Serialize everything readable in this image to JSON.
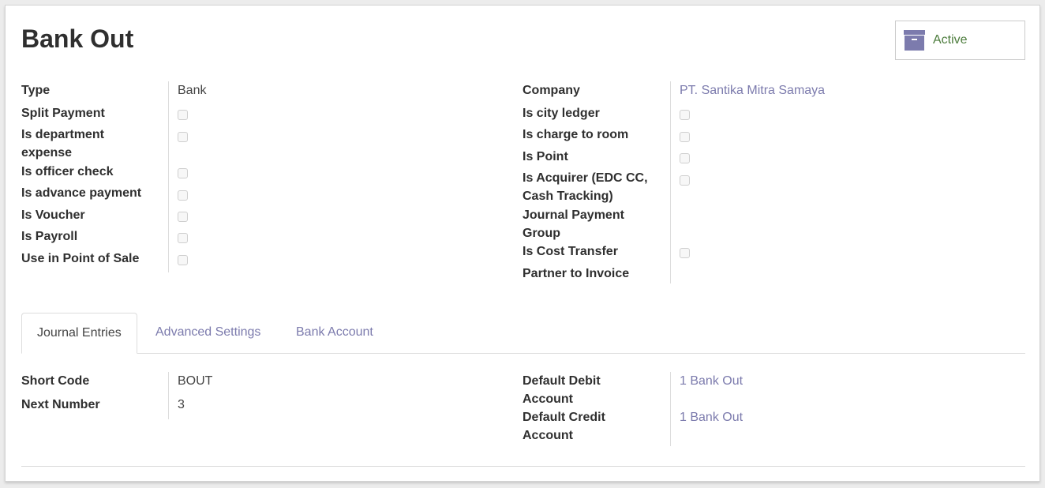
{
  "record": {
    "title": "Bank Out",
    "active_button": {
      "label": "Active",
      "icon": "archive-icon",
      "color": "#7c7bad",
      "text_color": "#4c7c3c"
    }
  },
  "left_group": {
    "fields": [
      {
        "label": "Type",
        "value": "Bank",
        "kind": "text"
      },
      {
        "label": "Split Payment",
        "kind": "checkbox",
        "checked": false
      },
      {
        "label": "Is department expense",
        "kind": "checkbox",
        "checked": false
      },
      {
        "label": "Is officer check",
        "kind": "checkbox",
        "checked": false
      },
      {
        "label": "Is advance payment",
        "kind": "checkbox",
        "checked": false
      },
      {
        "label": "Is Voucher",
        "kind": "checkbox",
        "checked": false
      },
      {
        "label": "Is Payroll",
        "kind": "checkbox",
        "checked": false
      },
      {
        "label": "Use in Point of Sale",
        "kind": "checkbox",
        "checked": false
      }
    ]
  },
  "right_group": {
    "fields": [
      {
        "label": "Company",
        "value": "PT. Santika Mitra Samaya",
        "kind": "link"
      },
      {
        "label": "Is city ledger",
        "kind": "checkbox",
        "checked": false
      },
      {
        "label": "Is charge to room",
        "kind": "checkbox",
        "checked": false
      },
      {
        "label": "Is Point",
        "kind": "checkbox",
        "checked": false
      },
      {
        "label": "Is Acquirer (EDC CC, Cash Tracking)",
        "kind": "checkbox",
        "checked": false
      },
      {
        "label": "Journal Payment Group",
        "value": "",
        "kind": "text"
      },
      {
        "label": "Is Cost Transfer",
        "kind": "checkbox",
        "checked": false
      },
      {
        "label": "Partner to Invoice",
        "value": "",
        "kind": "text"
      }
    ]
  },
  "tabs": [
    {
      "label": "Journal Entries",
      "active": true
    },
    {
      "label": "Advanced Settings",
      "active": false
    },
    {
      "label": "Bank Account",
      "active": false
    }
  ],
  "journal_entries": {
    "left": [
      {
        "label": "Short Code",
        "value": "BOUT"
      },
      {
        "label": "Next Number",
        "value": "3"
      }
    ],
    "right": [
      {
        "label": "Default Debit Account",
        "value": "1 Bank Out"
      },
      {
        "label": "Default Credit Account",
        "value": "1 Bank Out"
      }
    ]
  }
}
